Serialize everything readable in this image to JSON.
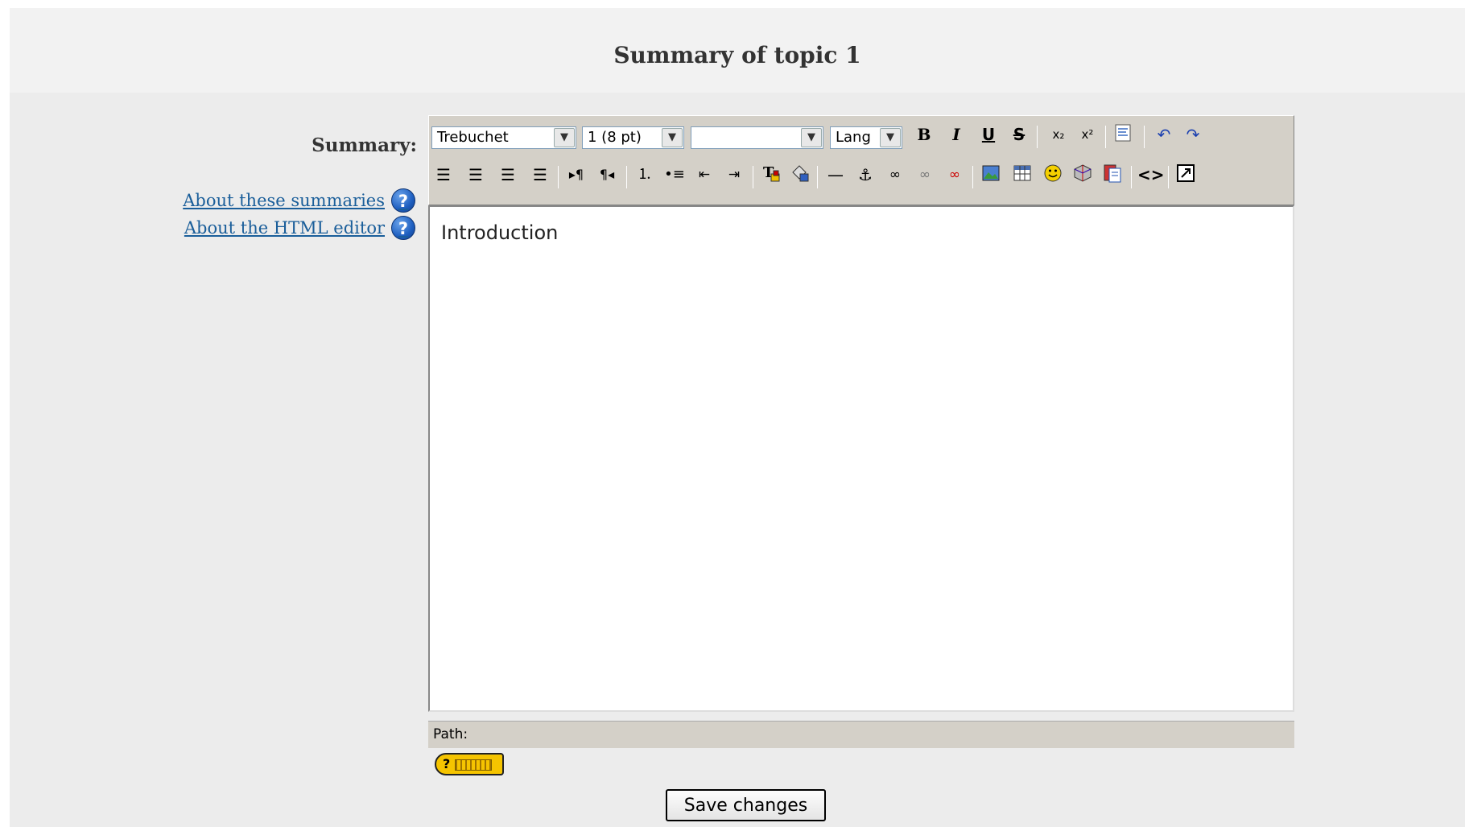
{
  "header": {
    "title": "Summary of topic 1"
  },
  "form": {
    "summary_label": "Summary:",
    "help_links": [
      {
        "label": "About these summaries"
      },
      {
        "label": "About the HTML editor"
      }
    ]
  },
  "editor": {
    "font_family": "Trebuchet",
    "font_size": "1 (8 pt)",
    "format": "",
    "lang": "Lang",
    "content": "Introduction",
    "path_label": "Path:"
  },
  "buttons": {
    "save": "Save changes"
  },
  "icons": {
    "help": "question-circle-icon",
    "keyboard_help": "keyboard-help-icon"
  },
  "colors": {
    "page_bg": "#ececec",
    "header_bg": "#f2f2f2",
    "toolbar_bg": "#d4d0c8",
    "link": "#1a5e9a",
    "kbd_help_bg": "#f5c400"
  }
}
